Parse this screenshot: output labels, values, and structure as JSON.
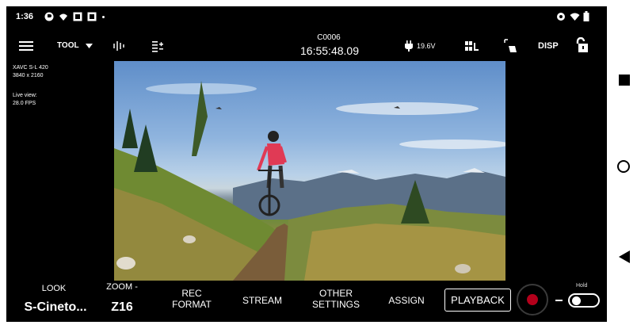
{
  "status_bar": {
    "time": "1:36"
  },
  "toolbar": {
    "tool_label": "TOOL",
    "clip_number": "C0006",
    "timecode": "16:55:48.09",
    "battery_voltage": "19.6V",
    "disp_label": "DISP"
  },
  "info": {
    "codec": "XAVC S-L 420",
    "resolution": "3840 x 2160",
    "live_view_label": "Live view:",
    "live_view_fps": "28.0 FPS"
  },
  "bottom_bar": {
    "look_label": "LOOK",
    "look_value": "S-Cineto...",
    "zoom_label": "ZOOM -",
    "zoom_value": "Z16",
    "rec_format_label": "REC FORMAT",
    "stream_label": "STREAM",
    "other_settings_label": "OTHER SETTINGS",
    "assign_label": "ASSIGN",
    "playback_label": "PLAYBACK",
    "hold_label": "Hold"
  },
  "colors": {
    "background": "#000000",
    "record_red": "#b3001b"
  },
  "icons": {
    "menu": "hamburger-icon",
    "tool_dropdown": "chevron-down-icon",
    "audio": "audio-level-icon",
    "exposure": "exposure-compensation-icon",
    "battery": "plug-icon",
    "histogram": "histogram-icon",
    "focus": "focus-area-icon",
    "lock": "unlock-icon"
  }
}
